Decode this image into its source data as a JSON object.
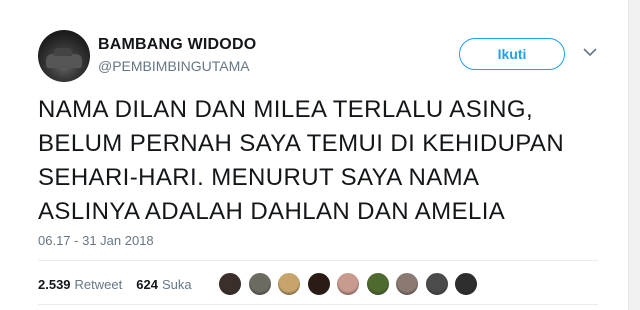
{
  "user": {
    "name": "BAMBANG WIDODO",
    "handle": "@PEMBIMBINGUTAMA"
  },
  "follow_label": "Ikuti",
  "tweet_lines": [
    "NAMA DILAN DAN MILEA TERLALU ASING,",
    "BELUM PERNAH SAYA TEMUI DI KEHIDUPAN",
    "SEHARI-HARI. MENURUT SAYA NAMA",
    "ASLINYA ADALAH DAHLAN DAN AMELIA"
  ],
  "timestamp": "06.17 - 31 Jan 2018",
  "stats": {
    "retweet_count": "2.539",
    "retweet_label": "Retweet",
    "like_count": "624",
    "like_label": "Suka"
  },
  "likers": [
    {
      "icon": "liker-avatar",
      "color": "#3a2f2a"
    },
    {
      "icon": "liker-avatar",
      "color": "#6d6a60"
    },
    {
      "icon": "liker-avatar",
      "color": "#c8a46a"
    },
    {
      "icon": "liker-avatar",
      "color": "#2a1b14"
    },
    {
      "icon": "liker-avatar",
      "color": "#c99a8e"
    },
    {
      "icon": "liker-avatar",
      "color": "#4e6a2e"
    },
    {
      "icon": "liker-avatar",
      "color": "#8a7a72"
    },
    {
      "icon": "liker-avatar",
      "color": "#4b4b4b"
    },
    {
      "icon": "liker-avatar",
      "color": "#2e2e2e"
    }
  ],
  "colors": {
    "accent": "#1da1f2",
    "secondary_text": "#657786"
  }
}
